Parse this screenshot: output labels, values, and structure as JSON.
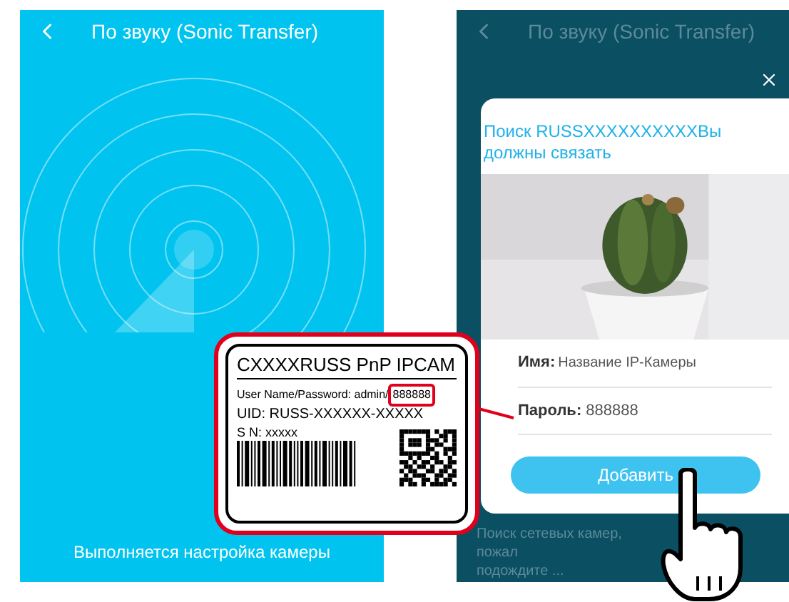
{
  "setup_screen": {
    "title": "По звуку (Sonic Transfer)",
    "status": "Выполняется настройка камеры"
  },
  "search_screen": {
    "title": "По звуку (Sonic Transfer)",
    "dialog": {
      "title": "Поиск RUSSXXXXXXXXXXВы должны связать",
      "name_label": "Имя:",
      "name_value": "Название IP-Камеры",
      "password_label": "Пароль:",
      "password_value": "888888",
      "add_button": "Добавить"
    },
    "status": "Поиск сетевых камер, пожал\nподождите ..."
  },
  "camera_sticker": {
    "title": "CXXXXRUSS PnP IPCAM",
    "credentials_label": "User Name/Password: admin/",
    "password": "888888",
    "uid": "UID: RUSS-XXXXXX-XXXXX",
    "sn": "S N: xxxxx"
  }
}
